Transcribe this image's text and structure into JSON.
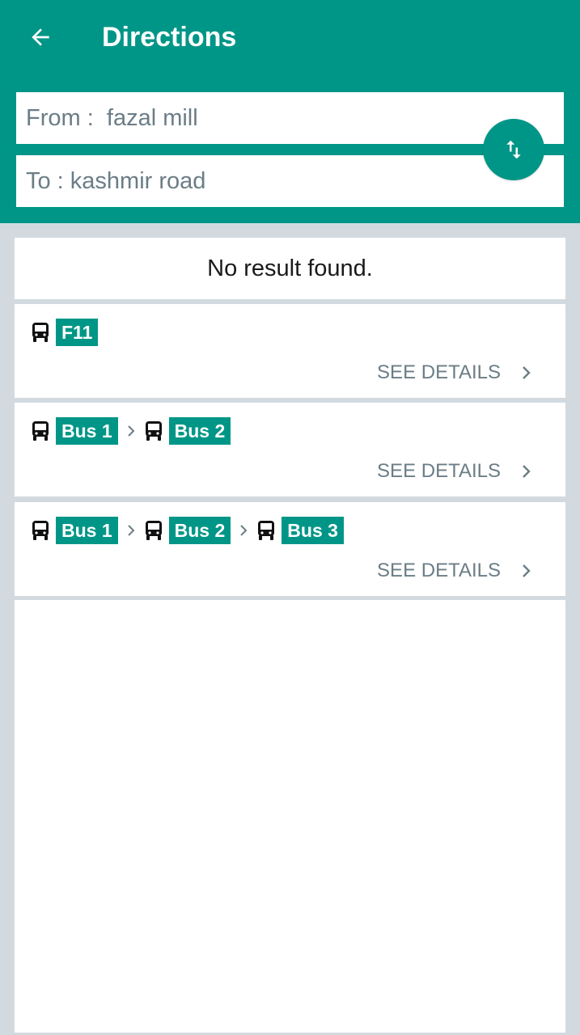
{
  "header": {
    "title": "Directions",
    "back_icon": "arrow-left-icon",
    "swap_icon": "swap-vertical-icon",
    "accent": "#009687"
  },
  "search": {
    "from_value": "From :  fazal mill",
    "to_value": "To : kashmir road"
  },
  "status": {
    "message": "No result found."
  },
  "routes": [
    {
      "legs": [
        "F11"
      ],
      "details_label": "SEE DETAILS"
    },
    {
      "legs": [
        "Bus 1",
        "Bus 2"
      ],
      "details_label": "SEE DETAILS"
    },
    {
      "legs": [
        "Bus 1",
        "Bus 2",
        "Bus 3"
      ],
      "details_label": "SEE DETAILS"
    }
  ]
}
